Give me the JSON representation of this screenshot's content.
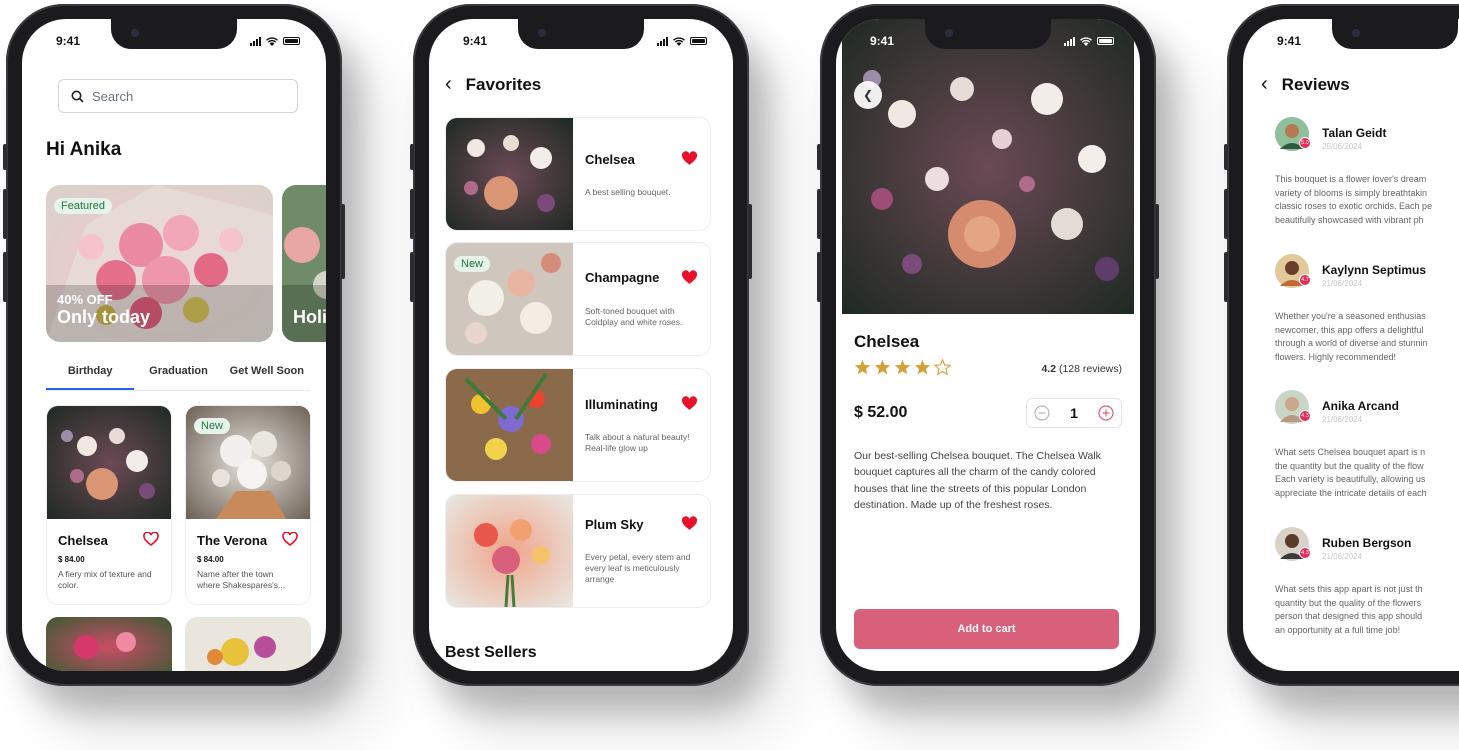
{
  "status": {
    "time": "9:41"
  },
  "home": {
    "search_placeholder": "Search",
    "greeting": "Hi Anika",
    "featured_badge": "Featured",
    "deal_discount": "40% OFF",
    "deal_title": "Only today",
    "next_card_partial": "Holi",
    "tabs": [
      "Birthday",
      "Graduation",
      "Get Well Soon"
    ],
    "active_tab": "Birthday",
    "products": [
      {
        "name": "Chelsea",
        "price": "$ 84.00",
        "desc": "A fiery mix of texture and color.",
        "badge": ""
      },
      {
        "name": "The Verona",
        "price": "$ 84.00",
        "desc": "Name after the town where Shakespares's...",
        "badge": "New"
      }
    ]
  },
  "favorites": {
    "title": "Favorites",
    "items": [
      {
        "name": "Chelsea",
        "desc": "A best selling bouquet.",
        "badge": ""
      },
      {
        "name": "Champagne",
        "desc": "Soft-toned bouquet with Coldplay and white roses.",
        "badge": "New"
      },
      {
        "name": "Illuminating",
        "desc": "Talk about a natural beauty! Real-life glow up",
        "badge": ""
      },
      {
        "name": "Plum Sky",
        "desc": "Every petal, every stem and every leaf is meticulously arrange",
        "badge": ""
      }
    ],
    "section_title": "Best Sellers"
  },
  "detail": {
    "name": "Chelsea",
    "stars_filled": 4,
    "stars_total": 5,
    "rating_value": "4.2",
    "rating_count": "(128 reviews)",
    "price": "$ 52.00",
    "quantity": "1",
    "description": "Our best-selling Chelsea bouquet. The Chelsea Walk bouquet captures all the charm of the candy colored houses that line the streets of this popular London destination. Made up of the freshest roses.",
    "add_to_cart": "Add to cart"
  },
  "reviews": {
    "title": "Reviews",
    "items": [
      {
        "name": "Talan Geidt",
        "date": "25/06/2024",
        "score": "5.0",
        "text": "This bouquet is a flower lover's dream\nvariety of blooms is simply breathtakin\nclassic roses to exotic orchids. Each pe\nbeautifully showcased with vibrant ph"
      },
      {
        "name": "Kaylynn Septimus",
        "date": "21/06/2024",
        "score": "4.7",
        "text": " Whether you're a seasoned enthusias\nnewcomer, this app offers a delightful\nthrough a world of diverse and stunnin\nflowers. Highly recommended!"
      },
      {
        "name": "Anika Arcand",
        "date": "21/06/2024",
        "score": "4.3",
        "text": "What sets Chelsea bouquet apart is n\nthe quantity but the quality of the flow\nEach variety is beautifully, allowing us\nappreciate the intricate details of each"
      },
      {
        "name": "Ruben Bergson",
        "date": "21/06/2024",
        "score": "4.3",
        "text": "What sets this app apart is not just th\nquantity but the quality of the flowers\nperson that designed this app should\nan opportunity at a full time job!"
      }
    ]
  },
  "colors": {
    "accent_blue": "#2563eb",
    "heart_red": "#e8102a",
    "cart_pink": "#d9607a",
    "star_gold": "#d4a23a",
    "badge_green": "#1e7a3d"
  }
}
